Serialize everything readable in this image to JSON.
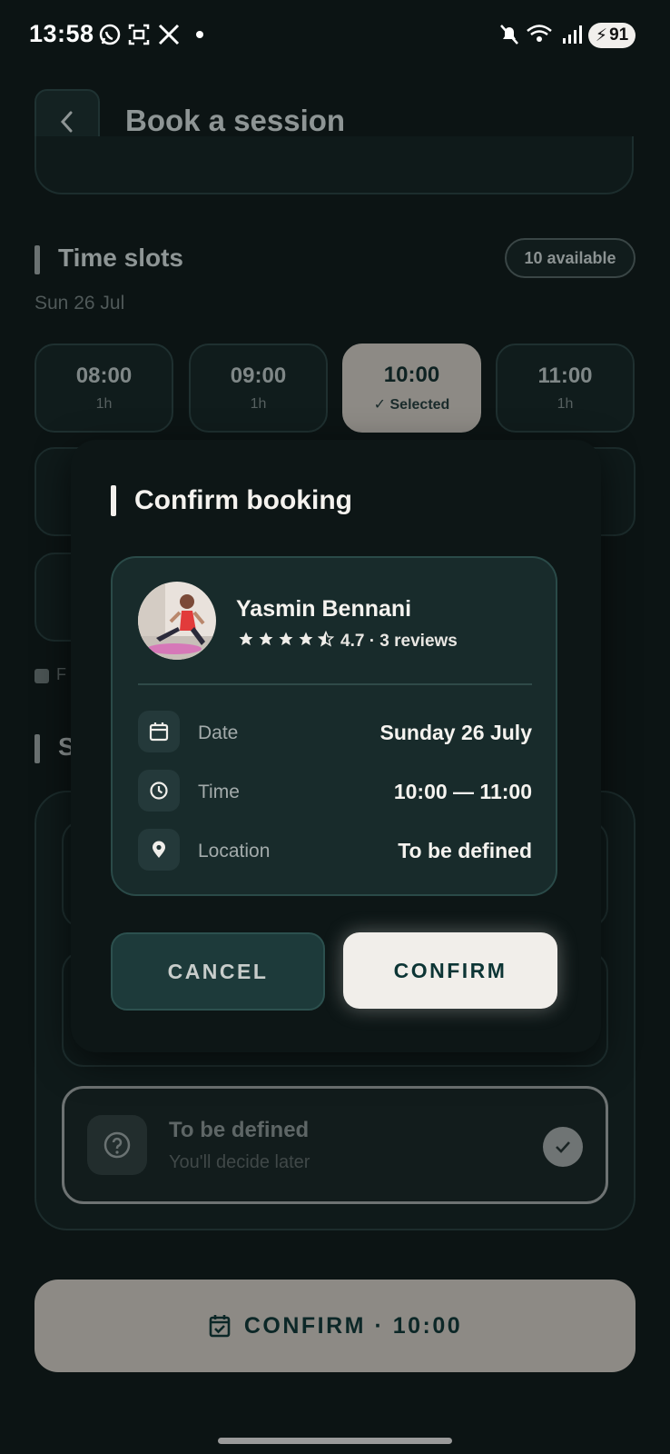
{
  "status_bar": {
    "time": "13:58",
    "battery": "91",
    "left_icons": [
      "whatsapp-icon",
      "screenshot-icon",
      "x-icon"
    ],
    "right_icons": [
      "mute-icon",
      "wifi-icon",
      "signal-icon"
    ]
  },
  "header": {
    "title": "Book a session"
  },
  "time_slots": {
    "title": "Time slots",
    "available": "10 available",
    "date": "Sun 26 Jul",
    "slots": [
      {
        "time": "08:00",
        "detail": "1h"
      },
      {
        "time": "09:00",
        "detail": "1h"
      },
      {
        "time": "10:00",
        "detail": "✓ Selected"
      },
      {
        "time": "11:00",
        "detail": "1h"
      }
    ],
    "legend_partial": "F",
    "location_section_partial": "S"
  },
  "location_option": {
    "title": "To be defined",
    "subtitle": "You'll decide later"
  },
  "bottom_button": {
    "label": "CONFIRM · 10:00"
  },
  "dialog": {
    "title": "Confirm booking",
    "coach": {
      "name": "Yasmin Bennani",
      "rating_stars": 4.5,
      "rating_text": "4.7 · 3 reviews"
    },
    "details": [
      {
        "icon": "calendar-icon",
        "label": "Date",
        "value": "Sunday 26 July"
      },
      {
        "icon": "clock-icon",
        "label": "Time",
        "value": "10:00 — 11:00"
      },
      {
        "icon": "location-pin-icon",
        "label": "Location",
        "value": "To be defined"
      }
    ],
    "cancel_label": "CANCEL",
    "confirm_label": "CONFIRM"
  },
  "colors": {
    "background": "#0c1414",
    "card": "#182b2b",
    "accent_light": "#f1eeea",
    "accent_dark": "#0d3535"
  }
}
